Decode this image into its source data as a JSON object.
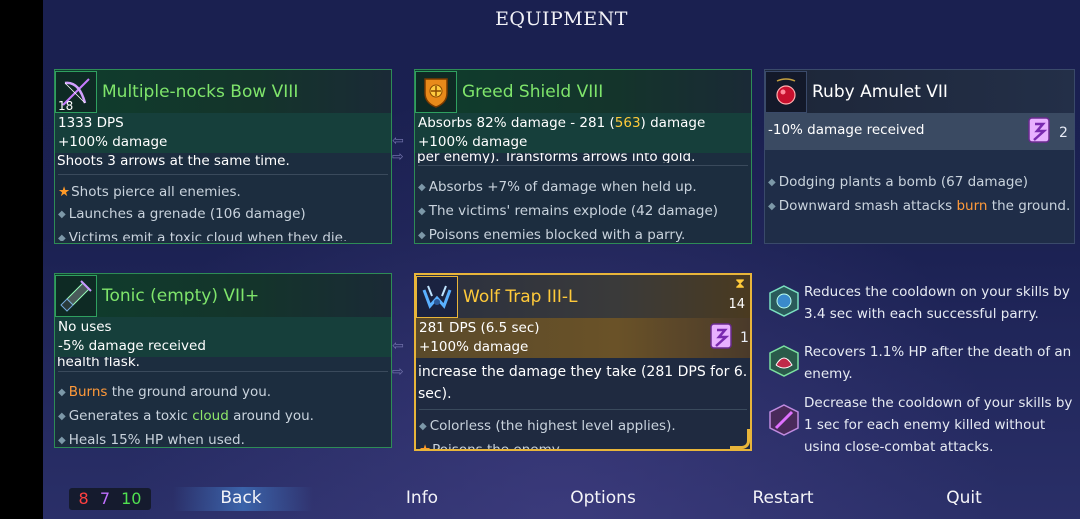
{
  "title": "EQUIPMENT",
  "colors": {
    "green_name": "#7fe56b",
    "gold_name": "#ffca3a",
    "orange_accent": "#ff9a28"
  },
  "cards": {
    "bow": {
      "icon": "bow-icon",
      "icon_num": "18",
      "name": "Multiple-nocks Bow VIII",
      "stat1": "1333 DPS",
      "stat2": "+100% damage",
      "desc": "Shoots 3 arrows at the same time.",
      "affix1": "Shots pierce all enemies.",
      "affix2": "Launches a grenade (106 damage)",
      "affix3": "Victims emit a toxic cloud when they die."
    },
    "shield": {
      "icon": "shield-icon",
      "name": "Greed Shield VIII",
      "stat1_pre": "Absorbs 82% damage - 281 (",
      "stat1_hl": "563",
      "stat1_post": ") damage",
      "stat2": "+100% damage",
      "desc": "per enemy). Transforms arrows into gold.",
      "affix1": "Absorbs +7% of damage when held up.",
      "affix2": "The victims' remains explode (42 damage)",
      "affix3": "Poisons enemies blocked with a parry."
    },
    "amulet": {
      "icon": "amulet-icon",
      "name": "Ruby Amulet VII",
      "stat1": "-10% damage received",
      "scroll_count": "2",
      "affix1": "Dodging plants a bomb (67 damage)",
      "affix2_pre": "Downward smash attacks ",
      "affix2_hl": "burn",
      "affix2_post": " the ground."
    },
    "tonic": {
      "icon": "tonic-icon",
      "name": "Tonic (empty) VII+",
      "stat1": "No uses",
      "stat2": "-5% damage received",
      "desc": "health flask.",
      "affix1_hl": "Burns",
      "affix1_post": " the ground around you.",
      "affix2_pre": "Generates a toxic ",
      "affix2_hl": "cloud",
      "affix2_post": " around you.",
      "affix3": "Heals 15% HP when used."
    },
    "trap": {
      "icon": "wolf-trap-icon",
      "name": "Wolf Trap III-L",
      "timer": "14",
      "stat1": "281 DPS (6.5 sec)",
      "stat2": "+100% damage",
      "scroll_count": "1",
      "desc1": "increase the damage they take (281 DPS for 6.5",
      "desc2": "sec).",
      "affix1": "Colorless (the highest level applies).",
      "affix2": "Poisons the enemy."
    }
  },
  "mutations": [
    {
      "icon": "parry-mutation-icon",
      "line1": "Reduces the cooldown on your skills by",
      "line2": "3.4 sec with each successful parry."
    },
    {
      "icon": "recovery-mutation-icon",
      "line1": "Recovers 1.1% HP after the death of an",
      "line2": "enemy."
    },
    {
      "icon": "scroll-mutation-icon",
      "line1": "Decrease the cooldown of your skills by",
      "line2": "1 sec for each enemy killed without",
      "line3": "using close-combat attacks."
    }
  ],
  "bottom": {
    "stat_red": "8",
    "stat_purple": "7",
    "stat_green": "10",
    "back": "Back",
    "info": "Info",
    "options": "Options",
    "restart": "Restart",
    "quit": "Quit"
  }
}
